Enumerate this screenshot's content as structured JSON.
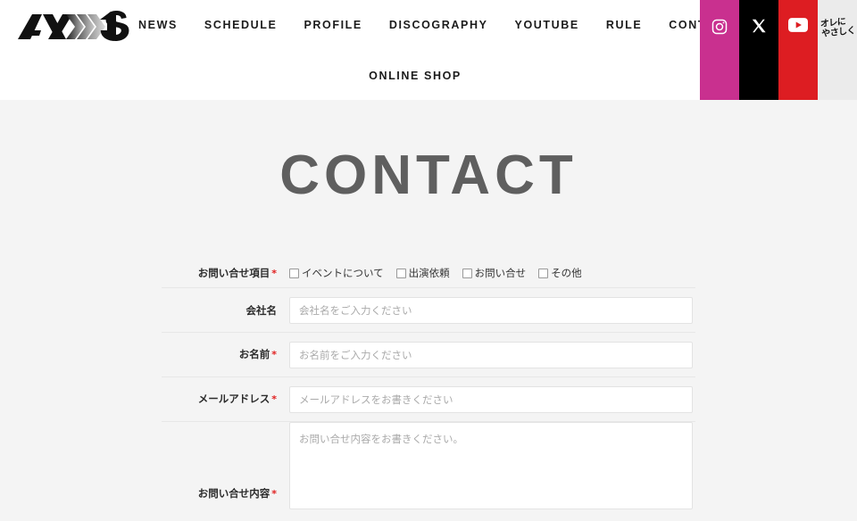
{
  "header": {
    "logo": {
      "name": "axxis-logo",
      "text": "AX1S"
    },
    "nav_primary": [
      {
        "label": "NEWS",
        "name": "nav-news"
      },
      {
        "label": "SCHEDULE",
        "name": "nav-schedule"
      },
      {
        "label": "PROFILE",
        "name": "nav-profile"
      },
      {
        "label": "DISCOGRAPHY",
        "name": "nav-discography"
      },
      {
        "label": "YOUTUBE",
        "name": "nav-youtube"
      },
      {
        "label": "RULE",
        "name": "nav-rule"
      },
      {
        "label": "CONTACT",
        "name": "nav-contact"
      }
    ],
    "nav_secondary": [
      {
        "label": "ONLINE SHOP",
        "name": "nav-online-shop"
      }
    ],
    "social": [
      {
        "name": "instagram-icon",
        "color": "#c9308f"
      },
      {
        "name": "x-twitter-icon",
        "color": "#000000"
      },
      {
        "name": "youtube-icon",
        "color": "#dd1d22"
      },
      {
        "name": "oreni-yasashiku-banner",
        "color": "#ebebeb",
        "line1": "オレに",
        "line2": "やさしく"
      }
    ]
  },
  "main": {
    "page_title": "CONTACT",
    "form": {
      "required_marker": "*",
      "rows": [
        {
          "label": "お問い合せ項目",
          "required": true,
          "type": "checkbox-group",
          "options": [
            "イベントについて",
            "出演依頼",
            "お問い合せ",
            "その他"
          ]
        },
        {
          "label": "会社名",
          "required": false,
          "type": "text",
          "value": "",
          "placeholder": "会社名をご入力ください"
        },
        {
          "label": "お名前",
          "required": true,
          "type": "text",
          "value": "",
          "placeholder": "お名前をご入力ください"
        },
        {
          "label": "メールアドレス",
          "required": true,
          "type": "text",
          "value": "",
          "placeholder": "メールアドレスをお書きください"
        },
        {
          "label": "お問い合せ内容",
          "required": true,
          "type": "textarea",
          "value": "",
          "placeholder": "お問い合せ内容をお書きください。"
        }
      ]
    }
  },
  "colors": {
    "page_background": "#f4f4f4",
    "header_background": "#ffffff",
    "title_gray": "#5f5f5f",
    "required_red": "#e02020",
    "instagram_magenta": "#c9308f",
    "youtube_red": "#dd1d22"
  }
}
